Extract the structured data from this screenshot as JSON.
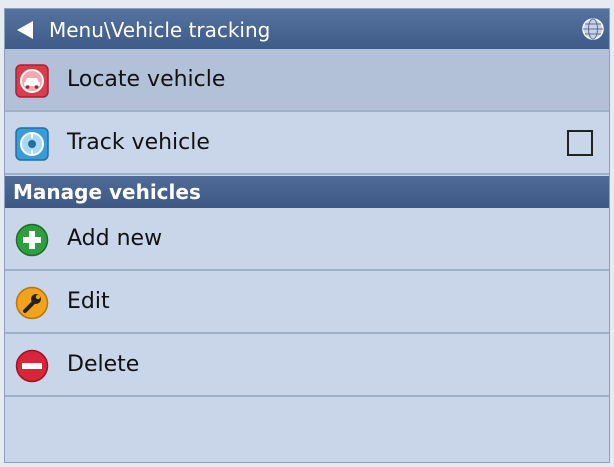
{
  "header": {
    "title": "Menu\\Vehicle tracking"
  },
  "items": [
    {
      "label": "Locate vehicle",
      "icon": "car-icon",
      "selected": true
    },
    {
      "label": "Track vehicle",
      "icon": "tracking-icon",
      "checkbox_checked": false
    }
  ],
  "section": {
    "title": "Manage vehicles"
  },
  "manage_items": [
    {
      "label": "Add new",
      "icon": "plus-icon"
    },
    {
      "label": "Edit",
      "icon": "wrench-icon"
    },
    {
      "label": "Delete",
      "icon": "minus-icon"
    }
  ],
  "colors": {
    "titlebar": "#3e5b88",
    "list_bg": "#c9d5e8",
    "selected_bg": "#b3c1d8"
  }
}
